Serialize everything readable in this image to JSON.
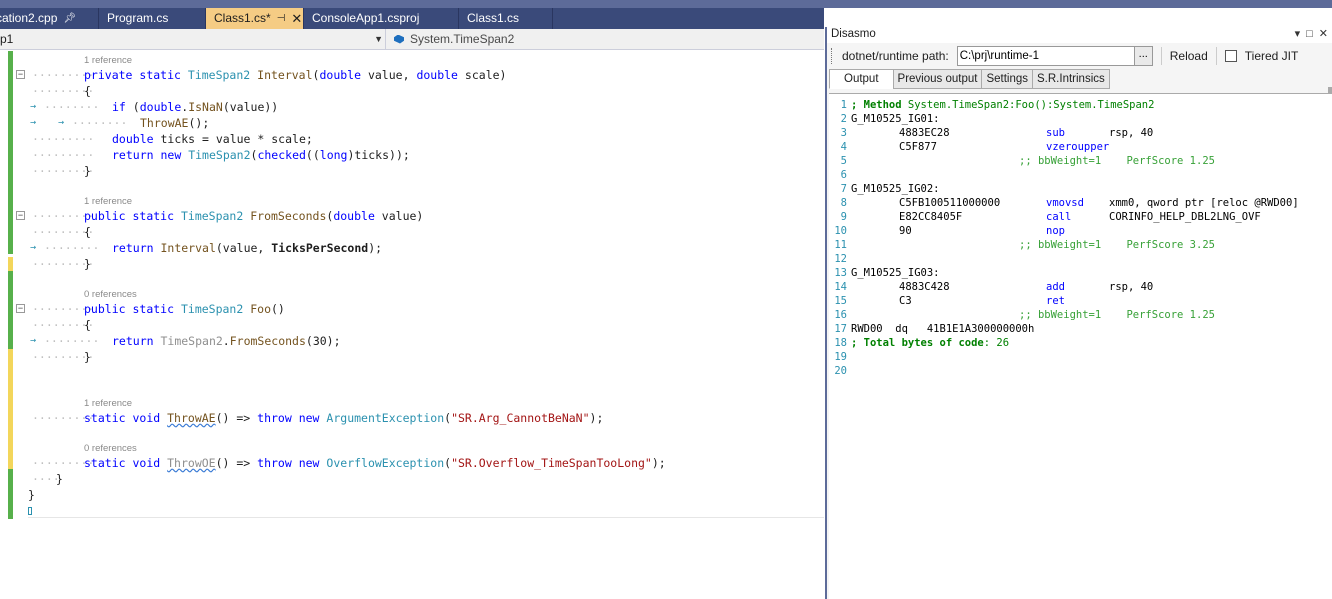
{
  "tabs": [
    {
      "label": "cation2.cpp",
      "pinned": true
    },
    {
      "label": "Program.cs"
    },
    {
      "label": "Class1.cs*",
      "active": true
    },
    {
      "label": "ConsoleApp1.csproj"
    },
    {
      "label": "Class1.cs"
    }
  ],
  "navbar": {
    "left": "p1",
    "right": "System.TimeSpan2"
  },
  "refs": {
    "r1": "1 reference",
    "r2": "1 reference",
    "r3": "0 references",
    "r4": "1 reference",
    "r5": "0 references"
  },
  "code": {
    "interval_sig": [
      "private",
      "static",
      "TimeSpan2",
      "Interval",
      "(",
      "double",
      "value,",
      "double",
      "scale)"
    ],
    "lines": {
      "l_brace1": "{",
      "l_if": "if (double.IsNaN(value))",
      "l_throwae": "ThrowAE();",
      "l_ticks": "double ticks = value * scale;",
      "l_ret1": "return new TimeSpan2(checked((long)ticks));",
      "l_close1": "}",
      "l_fromsec": "public static TimeSpan2 FromSeconds(double value)",
      "l_brace2": "{",
      "l_ret2": "return Interval(value, TicksPerSecond);",
      "l_close2": "}",
      "l_foo": "public static TimeSpan2 Foo()",
      "l_brace3": "{",
      "l_ret3": "return TimeSpan2.FromSeconds(30);",
      "l_close3": "}",
      "l_throwae_def": "static void ThrowAE() => throw new ArgumentException(\"SR.Arg_CannotBeNaN\");",
      "l_throwoe_def": "static void ThrowOE() => throw new OverflowException(\"SR.Overflow_TimeSpanTooLong\");",
      "l_close4": "}",
      "l_close5": "}"
    }
  },
  "disasmo": {
    "title": "Disasmo",
    "path_label": "dotnet/runtime path:",
    "path_value": "C:\\prj\\runtime-1",
    "browse": "...",
    "reload": "Reload",
    "tiered_jit": "Tiered JIT",
    "tabs": [
      "Output",
      "Previous output",
      "Settings",
      "S.R.Intrinsics"
    ],
    "lines": [
      {
        "n": "1",
        "text": "; Method System.TimeSpan2:Foo():System.TimeSpan2"
      },
      {
        "n": "2",
        "text": "G_M10525_IG01:"
      },
      {
        "n": "3",
        "hex": "4883EC28",
        "ins": "sub",
        "ops": "rsp, 40"
      },
      {
        "n": "4",
        "hex": "C5F877",
        "ins": "vzeroupper",
        "ops": ""
      },
      {
        "n": "5",
        "text": ";; bbWeight=1    PerfScore 1.25"
      },
      {
        "n": "6",
        "text": ""
      },
      {
        "n": "7",
        "text": "G_M10525_IG02:"
      },
      {
        "n": "8",
        "hex": "C5FB100511000000",
        "ins": "vmovsd",
        "ops": "xmm0, qword ptr [reloc @RWD00]"
      },
      {
        "n": "9",
        "hex": "E82CC8405F",
        "ins": "call",
        "ops": "CORINFO_HELP_DBL2LNG_OVF"
      },
      {
        "n": "10",
        "hex": "90",
        "ins": "nop",
        "ops": ""
      },
      {
        "n": "11",
        "text": ";; bbWeight=1    PerfScore 3.25"
      },
      {
        "n": "12",
        "text": ""
      },
      {
        "n": "13",
        "text": "G_M10525_IG03:"
      },
      {
        "n": "14",
        "hex": "4883C428",
        "ins": "add",
        "ops": "rsp, 40"
      },
      {
        "n": "15",
        "hex": "C3",
        "ins": "ret",
        "ops": ""
      },
      {
        "n": "16",
        "text": ";; bbWeight=1    PerfScore 1.25"
      },
      {
        "n": "17",
        "text": "RWD00  dq   41B1E1A300000000h"
      },
      {
        "n": "18",
        "text": "; Total bytes of code: 26"
      },
      {
        "n": "19",
        "text": ""
      },
      {
        "n": "20",
        "text": ""
      }
    ]
  }
}
